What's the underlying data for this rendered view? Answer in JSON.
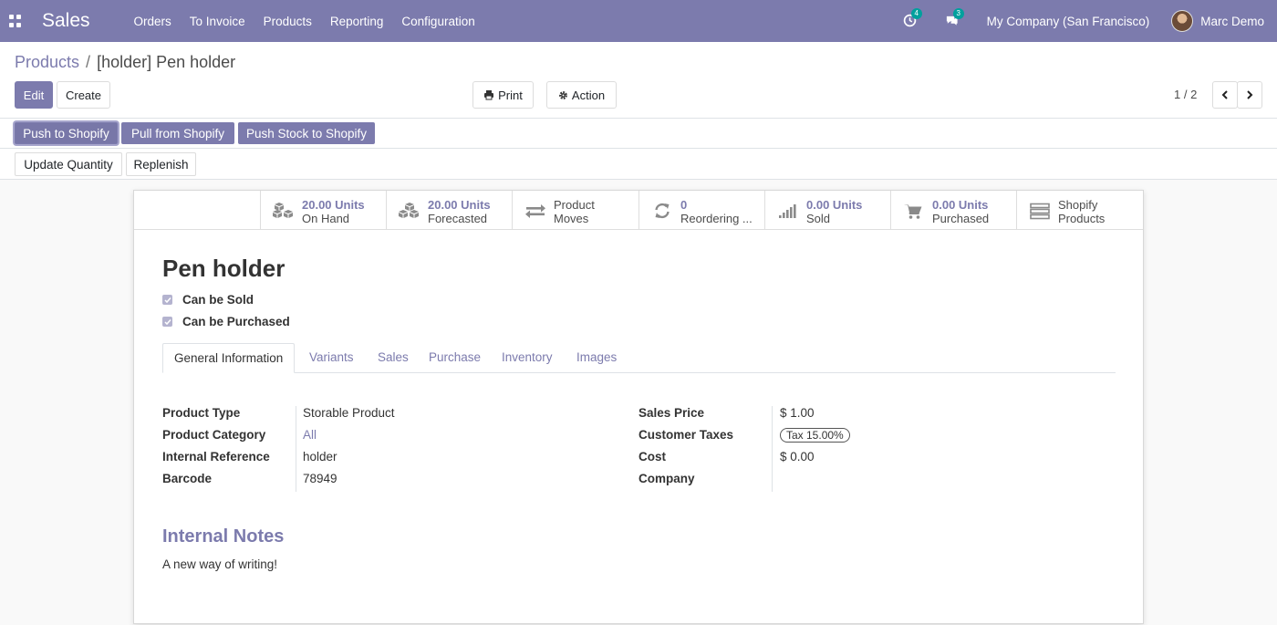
{
  "navbar": {
    "app_name": "Sales",
    "menu": [
      "Orders",
      "To Invoice",
      "Products",
      "Reporting",
      "Configuration"
    ],
    "activity_count": "4",
    "message_count": "3",
    "company": "My Company (San Francisco)",
    "user": "Marc Demo",
    "color": "#7c7bad"
  },
  "breadcrumb": {
    "parent": "Products",
    "separator": "/",
    "current": "[holder] Pen holder"
  },
  "control": {
    "edit": "Edit",
    "create": "Create",
    "print": "Print",
    "action": "Action",
    "pager": "1 / 2"
  },
  "shopify_buttons": [
    "Push to Shopify",
    "Pull from Shopify",
    "Push Stock to Shopify"
  ],
  "stock_buttons": [
    "Update Quantity",
    "Replenish"
  ],
  "smart_buttons": [
    {
      "value": "20.00 Units",
      "label": "On Hand",
      "icon": "cubes-icon"
    },
    {
      "value": "20.00 Units",
      "label": "Forecasted",
      "icon": "cubes-icon"
    },
    {
      "label": "Product",
      "label2": "Moves",
      "icon": "exchange-icon"
    },
    {
      "value": "0",
      "label": "Reordering ...",
      "icon": "refresh-icon"
    },
    {
      "value": "0.00 Units",
      "label": "Sold",
      "icon": "signal-icon"
    },
    {
      "value": "0.00 Units",
      "label": "Purchased",
      "icon": "cart-icon"
    },
    {
      "label": "Shopify",
      "label2": "Products",
      "icon": "server-icon"
    }
  ],
  "product": {
    "name": "Pen holder",
    "can_be_sold": "Can be Sold",
    "can_be_purchased": "Can be Purchased"
  },
  "tabs": [
    "General Information",
    "Variants",
    "Sales",
    "Purchase",
    "Inventory",
    "Images"
  ],
  "fields_left": [
    {
      "label": "Product Type",
      "value": "Storable Product"
    },
    {
      "label": "Product Category",
      "value": "All"
    },
    {
      "label": "Internal Reference",
      "value": "holder"
    },
    {
      "label": "Barcode",
      "value": "78949"
    }
  ],
  "fields_right": [
    {
      "label": "Sales Price",
      "value": "$ 1.00"
    },
    {
      "label": "Customer Taxes",
      "value": "Tax 15.00%"
    },
    {
      "label": "Cost",
      "value": "$ 0.00"
    },
    {
      "label": "Company",
      "value": ""
    }
  ],
  "notes": {
    "title": "Internal Notes",
    "text": "A new way of writing!"
  }
}
